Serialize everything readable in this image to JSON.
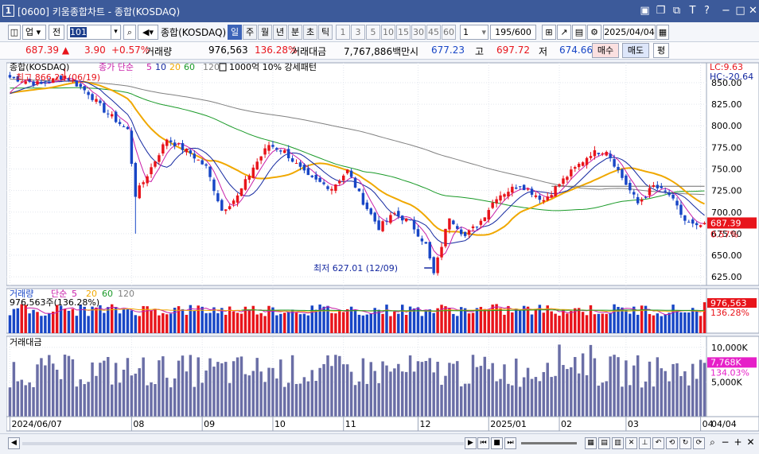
{
  "window": {
    "screen_no": "[0600]",
    "title": "키움종합차트 - 종합(KOSDAQ)",
    "app_icon": "1"
  },
  "toolbar": {
    "market": "업",
    "scope": "전",
    "code": "101",
    "name": "종합(KOSDAQ)",
    "periods": [
      "일",
      "주",
      "월",
      "년",
      "분",
      "초",
      "틱"
    ],
    "active_period": "일",
    "intervals": [
      "1",
      "3",
      "5",
      "10",
      "15",
      "30",
      "45",
      "60"
    ],
    "unit_value": "1",
    "count": "195",
    "count_max": "/600",
    "date": "2025/04/04"
  },
  "quote": {
    "price": "687.39",
    "change_arrow": "▲",
    "change": "3.90",
    "change_pct": "+0.57%",
    "volume_label": "거래량",
    "volume": "976,563",
    "volume_ratio": "136.28%",
    "amount_label": "거래대금",
    "amount": "7,767,886백만",
    "open_label": "시",
    "open": "677.23",
    "high_label": "고",
    "high": "697.72",
    "low_label": "저",
    "low": "674.66",
    "buy_label": "매수",
    "sell_label": "매도",
    "extra_label": "평"
  },
  "colors": {
    "up": "#e8141b",
    "down": "#1846c6",
    "ma5": "#c81ea8",
    "ma10": "#1428a0",
    "ma20": "#f0a800",
    "ma60": "#1a9a28",
    "ma120": "#808080",
    "trend": "#6f6f6f"
  },
  "chart_data": [
    {
      "type": "candlestick",
      "title": "종합(KOSDAQ)",
      "legend": [
        "종가 단순",
        "5",
        "10",
        "20",
        "60",
        "120",
        "1000억 10% 강세패턴"
      ],
      "high_annotation": "최고 866.21 (06/19)",
      "low_annotation": "최저 627.01 (12/09)",
      "lc": "LC:9.63",
      "hc": "HC:-20.64",
      "price_label": "687.39",
      "pct_label": "0.57%",
      "yticks": [
        "850.00",
        "825.00",
        "800.00",
        "775.00",
        "750.00",
        "725.00",
        "700.00",
        "675.00",
        "650.00",
        "625.00"
      ],
      "yvalues": [
        850,
        825,
        800,
        775,
        750,
        725,
        700,
        675,
        650,
        625
      ],
      "ylim": [
        615,
        873
      ],
      "anchors": [
        {
          "day": 0,
          "v": 856
        },
        {
          "day": 8,
          "v": 848
        },
        {
          "day": 14,
          "v": 858
        },
        {
          "day": 20,
          "v": 838
        },
        {
          "day": 24,
          "v": 818
        },
        {
          "day": 30,
          "v": 795
        },
        {
          "day": 32,
          "v": 720
        },
        {
          "day": 34,
          "v": 735
        },
        {
          "day": 40,
          "v": 785
        },
        {
          "day": 46,
          "v": 768
        },
        {
          "day": 50,
          "v": 752
        },
        {
          "day": 54,
          "v": 702
        },
        {
          "day": 58,
          "v": 718
        },
        {
          "day": 62,
          "v": 752
        },
        {
          "day": 66,
          "v": 778
        },
        {
          "day": 70,
          "v": 770
        },
        {
          "day": 76,
          "v": 740
        },
        {
          "day": 82,
          "v": 728
        },
        {
          "day": 86,
          "v": 748
        },
        {
          "day": 90,
          "v": 712
        },
        {
          "day": 94,
          "v": 682
        },
        {
          "day": 98,
          "v": 698
        },
        {
          "day": 102,
          "v": 688
        },
        {
          "day": 106,
          "v": 662
        },
        {
          "day": 108,
          "v": 628
        },
        {
          "day": 112,
          "v": 695
        },
        {
          "day": 116,
          "v": 672
        },
        {
          "day": 120,
          "v": 690
        },
        {
          "day": 124,
          "v": 718
        },
        {
          "day": 130,
          "v": 732
        },
        {
          "day": 136,
          "v": 714
        },
        {
          "day": 142,
          "v": 742
        },
        {
          "day": 148,
          "v": 768
        },
        {
          "day": 152,
          "v": 772
        },
        {
          "day": 156,
          "v": 740
        },
        {
          "day": 160,
          "v": 710
        },
        {
          "day": 164,
          "v": 730
        },
        {
          "day": 168,
          "v": 720
        },
        {
          "day": 172,
          "v": 690
        },
        {
          "day": 175,
          "v": 682
        },
        {
          "day": 177,
          "v": 687
        }
      ]
    },
    {
      "type": "bar",
      "title": "거래량",
      "legend": [
        "단순",
        "5",
        "20",
        "60",
        "120"
      ],
      "label": "976,563주(136.28%)",
      "price_label": "976,563",
      "pct_label": "136.28%"
    },
    {
      "type": "bar",
      "title": "거래대금",
      "yticks": [
        "10,000K",
        "5,000K"
      ],
      "yvalues": [
        10000,
        5000
      ],
      "ylim": [
        0,
        11600
      ],
      "price_label": "7,768K",
      "pct_label": "134.03%"
    }
  ],
  "xaxis": {
    "labels": [
      "2024/06/07",
      "08",
      "09",
      "10",
      "11",
      "12",
      "2025/01",
      "02",
      "03",
      "04"
    ],
    "label_days": [
      0,
      31,
      49,
      67,
      85,
      104,
      122,
      140,
      157,
      176
    ],
    "right_label": "04/04",
    "days": 178
  }
}
